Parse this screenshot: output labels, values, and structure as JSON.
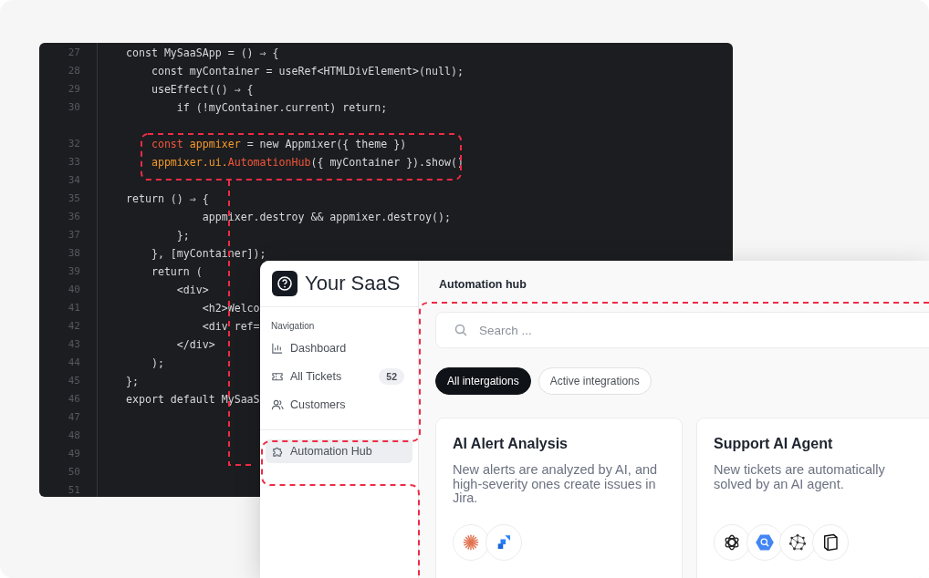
{
  "editor": {
    "lines": [
      {
        "number": "27",
        "code": "const MySaaSApp = () ⇒ {"
      },
      {
        "number": "28",
        "code": "    const myContainer = useRef<HTMLDivElement>(null);"
      },
      {
        "number": "29",
        "code": "    useEffect(() ⇒ {"
      },
      {
        "number": "30",
        "code": "        if (!myContainer.current) return;"
      },
      {
        "number": "32",
        "gap_before": true,
        "tokens": [
          {
            "text": "    const ",
            "kind": "keyword"
          },
          {
            "text": "appmixer",
            "kind": "name"
          },
          {
            "text": " = new Appmixer({ theme })",
            "kind": "plain"
          }
        ]
      },
      {
        "number": "33",
        "tokens": [
          {
            "text": "    appmixer.ui.",
            "kind": "name"
          },
          {
            "text": "AutomationHub",
            "kind": "keyword"
          },
          {
            "text": "({ myContainer }).show()",
            "kind": "plain"
          }
        ]
      },
      {
        "number": "34"
      },
      {
        "number": "35",
        "code": "return () ⇒ {"
      },
      {
        "number": "36",
        "code": "            appmixer.destroy && appmixer.destroy();"
      },
      {
        "number": "37",
        "code": "        };"
      },
      {
        "number": "38",
        "code": "    }, [myContainer]);"
      },
      {
        "number": "39",
        "code": "    return ("
      },
      {
        "number": "40",
        "code": "        <div>"
      },
      {
        "number": "41",
        "code": "            <h2>Welco"
      },
      {
        "number": "42",
        "code": "            <div ref="
      },
      {
        "number": "43",
        "code": "        </div>"
      },
      {
        "number": "44",
        "code": "    );"
      },
      {
        "number": "45",
        "code": "};"
      },
      {
        "number": "46",
        "code": "export default MySaaS"
      },
      {
        "number": "47"
      },
      {
        "number": "48"
      },
      {
        "number": "49"
      },
      {
        "number": "50"
      },
      {
        "number": "51"
      }
    ]
  },
  "app": {
    "brand": "Your SaaS",
    "sidebar": {
      "section": "Navigation",
      "items": [
        {
          "label": "Dashboard",
          "selected": false
        },
        {
          "label": "All Tickets",
          "badge": "52",
          "selected": false
        },
        {
          "label": "Customers",
          "selected": false
        }
      ],
      "bottom_items": [
        {
          "label": "Automation Hub",
          "selected": true
        }
      ]
    },
    "header": "Automation hub",
    "search": {
      "placeholder": "Search ..."
    },
    "tabs": [
      {
        "label": "All intergations",
        "selected": true
      },
      {
        "label": "Active integrations",
        "selected": false
      }
    ],
    "cards": [
      {
        "title": "AI Alert Analysis",
        "description": "New alerts are analyzed by AI, and high-severity ones create issues in Jira."
      },
      {
        "title": "Support AI Agent",
        "description": "New tickets are automatically solved by an AI agent."
      }
    ]
  }
}
